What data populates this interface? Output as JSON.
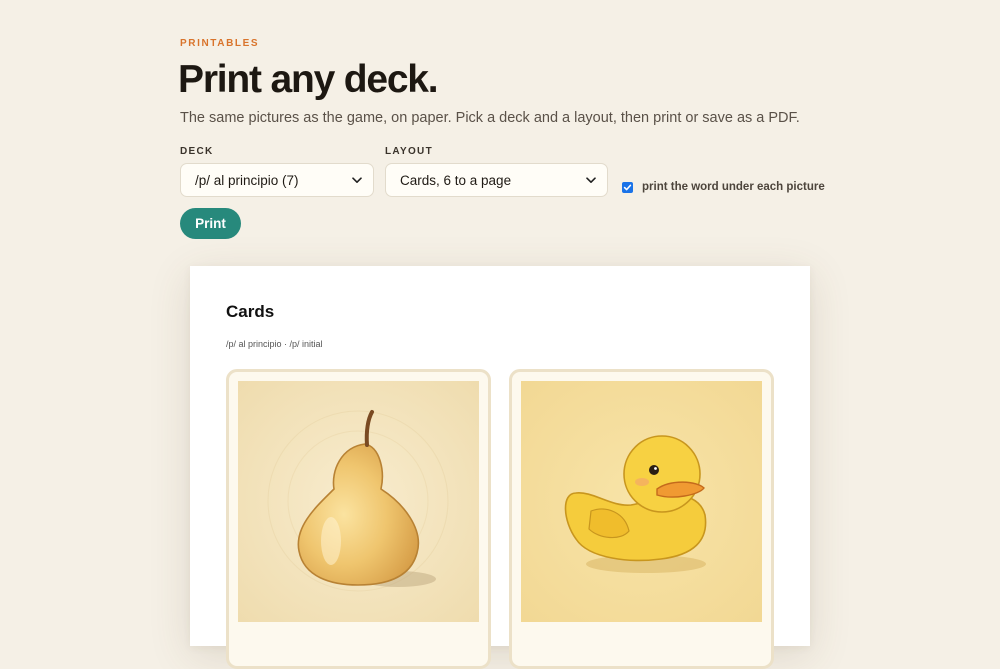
{
  "header": {
    "eyebrow": "PRINTABLES",
    "title": "Print any deck.",
    "subtitle": "The same pictures as the game, on paper. Pick a deck and a layout, then print or save as a PDF."
  },
  "controls": {
    "deck": {
      "label": "DECK",
      "selected": "/p/ al principio (7)"
    },
    "layout": {
      "label": "LAYOUT",
      "selected": "Cards, 6 to a page"
    },
    "show_words": {
      "label": "print the word under each picture",
      "checked": true
    },
    "print_label": "Print"
  },
  "preview": {
    "title": "Cards",
    "subtitle": "/p/ al principio · /p/ initial",
    "cards": [
      {
        "picture": "pear-illustration"
      },
      {
        "picture": "rubber-duck-illustration"
      }
    ]
  },
  "colors": {
    "background": "#f5f0e6",
    "accent": "#d9742c",
    "primary_button": "#27897c",
    "checkbox": "#1a73e8",
    "card_border": "#ece1c8"
  }
}
